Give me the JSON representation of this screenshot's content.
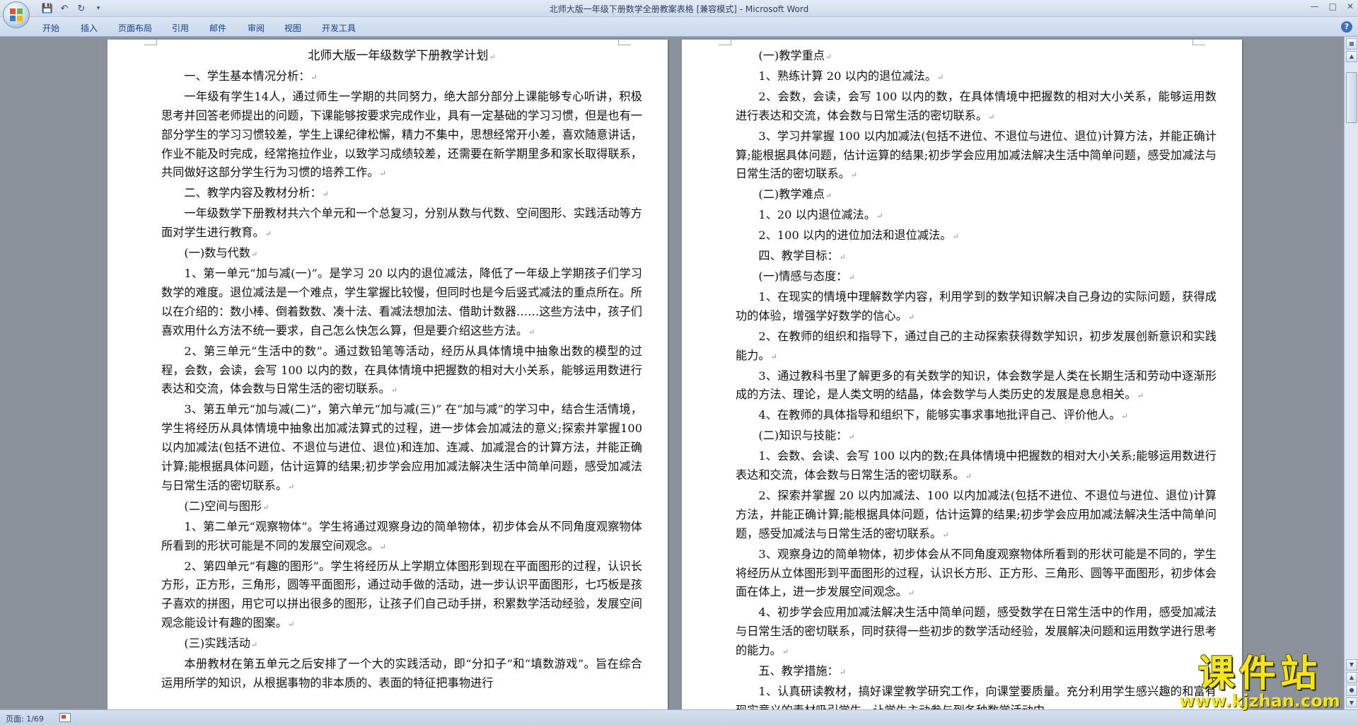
{
  "window": {
    "title": "北师大版一年级下册数学全册教案表格 [兼容模式] - Microsoft Word"
  },
  "quick_access": [
    "save-icon",
    "undo-icon",
    "redo-icon",
    "customize-icon"
  ],
  "ribbon_tabs": [
    "开始",
    "插入",
    "页面布局",
    "引用",
    "邮件",
    "审阅",
    "视图",
    "开发工具"
  ],
  "status": {
    "page": "页面: 1/69"
  },
  "watermark": {
    "text": "课件站",
    "url": "www.kjzhan.com"
  },
  "left_page": {
    "title": "北师大版一年级数学下册教学计划",
    "paragraphs": [
      "一、学生基本情况分析：",
      "一年级有学生14人，通过师生一学期的共同努力，绝大部分部分上课能够专心听讲，积极思考并回答老师提出的问题，下课能够按要求完成作业，具有一定基础的学习习惯，但是也有一部分学生的学习习惯较差，学生上课纪律松懈，精力不集中，思想经常开小差，喜欢随意讲话，作业不能及时完成，经常拖拉作业，以致学习成绩较差，还需要在新学期里多和家长取得联系，共同做好这部分学生行为习惯的培养工作。",
      "二、教学内容及教材分析：",
      "一年级数学下册教材共六个单元和一个总复习，分别从数与代数、空间图形、实践活动等方面对学生进行教育。",
      "(一)数与代数",
      "1、第一单元“加与减(一)”。是学习 20 以内的退位减法，降低了一年级上学期孩子们学习数学的难度。退位减法是一个难点，学生掌握比较慢，但同时也是今后竖式减法的重点所在。所以在介绍的：数小棒、倒着数数、凑十法、看减法想加法、借助计数器……这些方法中，孩子们喜欢用什么方法不统一要求，自己怎么快怎么算，但是要介绍这些方法。",
      "2、第三单元“生活中的数”。通过数铅笔等活动，经历从具体情境中抽象出数的模型的过程，会数，会读，会写 100 以内的数，在具体情境中把握数的相对大小关系，能够运用数进行表达和交流，体会数与日常生活的密切联系。",
      "3、第五单元“加与减(二)”，第六单元“加与减(三)” 在“加与减”的学习中，结合生活情境，学生将经历从具体情境中抽象出加减法算式的过程，进一步体会加减法的意义;探索并掌握100以内加减法(包括不进位、不退位与进位、退位)和连加、连减、加减混合的计算方法，并能正确计算;能根据具体问题，估计运算的结果;初步学会应用加减法解决生活中简单问题，感受加减法与日常生活的密切联系。",
      "(二)空间与图形",
      "1、第二单元“观察物体”。学生将通过观察身边的简单物体，初步体会从不同角度观察物体所看到的形状可能是不同的发展空间观念。",
      "2、第四单元“有趣的图形”。学生将经历从上学期立体图形到现在平面图形的过程，认识长方形，正方形，三角形，圆等平面图形，通过动手做的活动，进一步认识平面图形，七巧板是孩子喜欢的拼图，用它可以拼出很多的图形，让孩子们自己动手拼，积累数学活动经验，发展空间观念能设计有趣的图案。",
      "(三)实践活动",
      "本册教材在第五单元之后安排了一个大的实践活动，即“分扣子”和“填数游戏”。旨在综合运用所学的知识，从根据事物的非本质的、表面的特征把事物进行"
    ]
  },
  "right_page": {
    "paragraphs": [
      "(一)教学重点",
      "1、熟练计算 20 以内的退位减法。",
      "2、会数，会读，会写 100 以内的数，在具体情境中把握数的相对大小关系，能够运用数进行表达和交流，体会数与日常生活的密切联系。",
      "3、学习并掌握 100 以内加减法(包括不进位、不退位与进位、退位)计算方法，并能正确计算;能根据具体问题，估计运算的结果;初步学会应用加减法解决生活中简单问题，感受加减法与日常生活的密切联系。",
      "(二)教学难点",
      "1、20 以内退位减法。",
      "2、100 以内的进位加法和退位减法。",
      "四、教学目标：",
      "(一)情感与态度：",
      "1、在现实的情境中理解数学内容，利用学到的数学知识解决自己身边的实际问题，获得成功的体验，增强学好数学的信心。",
      "2、在教师的组织和指导下，通过自己的主动探索获得数学知识，初步发展创新意识和实践能力。",
      "3、通过教科书里了解更多的有关数学的知识，体会数学是人类在长期生活和劳动中逐渐形成的方法、理论，是人类文明的结晶，体会数学与人类历史的发展是息息相关。",
      "4、在教师的具体指导和组织下，能够实事求事地批评自己、评价他人。",
      "(二)知识与技能：",
      "1、会数、会读、会写 100 以内的数;在具体情境中把握数的相对大小关系;能够运用数进行表达和交流，体会数与日常生活的密切联系。",
      "2、探索并掌握 20 以内加减法、100 以内加减法(包括不进位、不退位与进位、退位)计算方法，并能正确计算;能根据具体问题，估计运算的结果;初步学会应用加减法解决生活中简单问题，感受加减法与日常生活的密切联系。",
      "3、观察身边的简单物体，初步体会从不同角度观察物体所看到的形状可能是不同的，学生将经历从立体图形到平面图形的过程，认识长方形、正方形、三角形、圆等平面图形，初步体会面在体上，进一步发展空间观念。",
      "4、初步学会应用加减法解决生活中简单问题，感受数学在日常生活中的作用，感受加减法与日常生活的密切联系，同时获得一些初步的数学活动经验，发展解决问题和运用数学进行思考的能力。",
      "五、教学措施：",
      "1、认真研读教材，搞好课堂教学研究工作，向课堂要质量。充分利用学生感兴趣的和富有现实意义的素材吸引学生，让学生主动参与到各种数学活动中"
    ]
  }
}
